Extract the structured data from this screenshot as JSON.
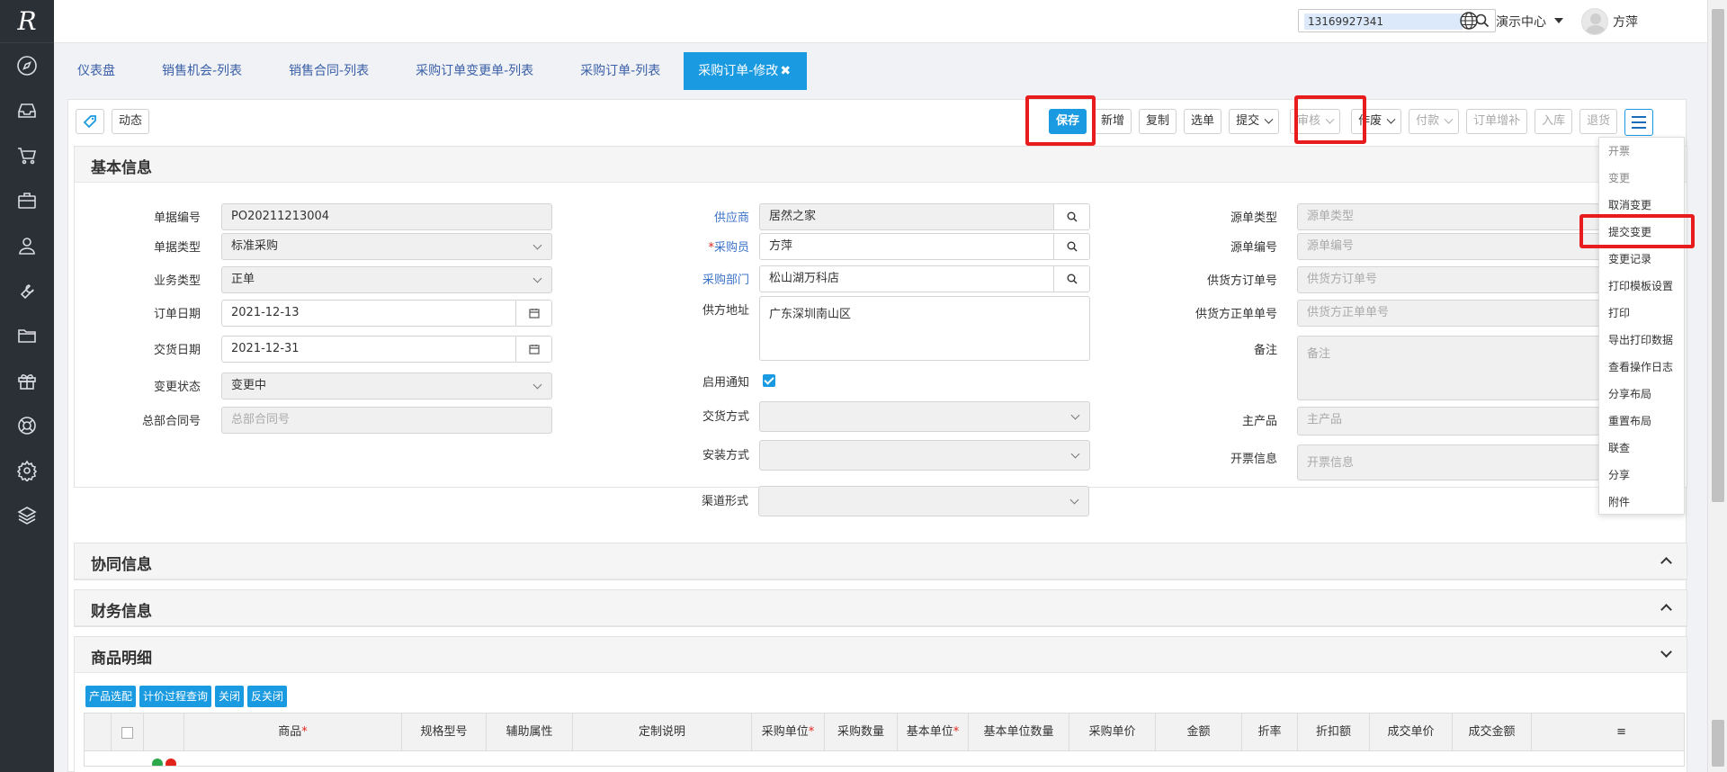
{
  "sidebar": {
    "logo": "R",
    "icons": [
      "compass-icon",
      "inbox-icon",
      "cart-icon",
      "briefcase-icon",
      "user-icon",
      "wrench-icon",
      "folder-icon",
      "gift-icon",
      "lifebuoy-icon",
      "gear-icon",
      "layers-icon"
    ]
  },
  "header": {
    "search_value": "13169927341",
    "demo_center": "演示中心",
    "username": "方萍"
  },
  "tabs": [
    {
      "label": "仪表盘",
      "active": false
    },
    {
      "label": "销售机会-列表",
      "active": false
    },
    {
      "label": "销售合同-列表",
      "active": false
    },
    {
      "label": "采购订单变更单-列表",
      "active": false
    },
    {
      "label": "采购订单-列表",
      "active": false
    },
    {
      "label": "采购订单-修改",
      "active": true
    }
  ],
  "toolbar": {
    "dynamic": "动态",
    "save": "保存",
    "new": "新增",
    "copy": "复制",
    "select": "选单",
    "submit": "提交",
    "audit": "审核",
    "void": "作废",
    "pay": "付款",
    "supplement": "订单增补",
    "stock_in": "入库",
    "return": "退货"
  },
  "sections": {
    "basic": "基本信息",
    "collab": "协同信息",
    "finance": "财务信息",
    "goods": "商品明细"
  },
  "form": {
    "doc_no_label": "单据编号",
    "doc_no": "PO20211213004",
    "doc_type_label": "单据类型",
    "doc_type": "标准采购",
    "biz_type_label": "业务类型",
    "biz_type": "正单",
    "order_date_label": "订单日期",
    "order_date": "2021-12-13",
    "delivery_date_label": "交货日期",
    "delivery_date": "2021-12-31",
    "change_status_label": "变更状态",
    "change_status": "变更中",
    "hq_contract_label": "总部合同号",
    "hq_contract_ph": "总部合同号",
    "supplier_label": "供应商",
    "supplier": "居然之家",
    "buyer_label": "采购员",
    "buyer": "方萍",
    "dept_label": "采购部门",
    "dept": "松山湖万科店",
    "supplier_addr_label": "供方地址",
    "supplier_addr": "广东深圳南山区",
    "notify_label": "启用通知",
    "delivery_mode_label": "交货方式",
    "install_mode_label": "安装方式",
    "channel_label": "渠道形式",
    "src_type_label": "源单类型",
    "src_type_ph": "源单类型",
    "src_no_label": "源单编号",
    "src_no_ph": "源单编号",
    "supplier_order_label": "供货方订单号",
    "supplier_order_ph": "供货方订单号",
    "supplier_formal_label": "供货方正单单号",
    "supplier_formal_ph": "供货方正单单号",
    "remark_label": "备注",
    "remark_ph": "备注",
    "main_product_label": "主产品",
    "main_product_ph": "主产品",
    "invoice_label": "开票信息",
    "invoice_ph": "开票信息"
  },
  "dropdown_menu": [
    "开票",
    "变更",
    "取消变更",
    "提交变更",
    "变更记录",
    "打印模板设置",
    "打印",
    "导出打印数据",
    "查看操作日志",
    "分享布局",
    "重置布局",
    "联查",
    "分享",
    "附件"
  ],
  "grid": {
    "buttons": [
      "产品选配",
      "计价过程查询",
      "关闭",
      "反关闭"
    ],
    "columns": [
      "商品",
      "规格型号",
      "辅助属性",
      "定制说明",
      "采购单位",
      "采购数量",
      "基本单位",
      "基本单位数量",
      "采购单价",
      "金额",
      "折率",
      "折扣额",
      "成交单价",
      "成交金额"
    ]
  }
}
